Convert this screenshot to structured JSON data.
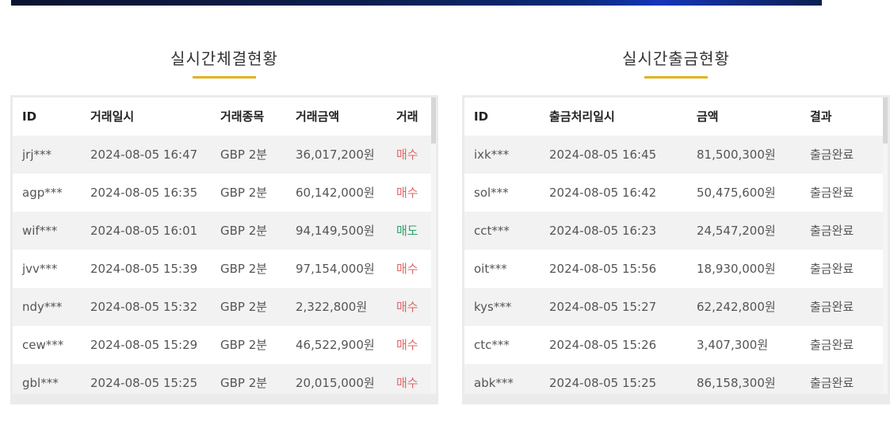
{
  "trades": {
    "title": "실시간체결현황",
    "headers": [
      "ID",
      "거래일시",
      "거래종목",
      "거래금액",
      "거래"
    ],
    "rows": [
      {
        "id": "jrj***",
        "datetime": "2024-08-05 16:47",
        "item": "GBP 2분",
        "amount": "36,017,200원",
        "type": "매수",
        "type_kind": "buy"
      },
      {
        "id": "agp***",
        "datetime": "2024-08-05 16:35",
        "item": "GBP 2분",
        "amount": "60,142,000원",
        "type": "매수",
        "type_kind": "buy"
      },
      {
        "id": "wif***",
        "datetime": "2024-08-05 16:01",
        "item": "GBP 2분",
        "amount": "94,149,500원",
        "type": "매도",
        "type_kind": "sell"
      },
      {
        "id": "jvv***",
        "datetime": "2024-08-05 15:39",
        "item": "GBP 2분",
        "amount": "97,154,000원",
        "type": "매수",
        "type_kind": "buy"
      },
      {
        "id": "ndy***",
        "datetime": "2024-08-05 15:32",
        "item": "GBP 2분",
        "amount": "2,322,800원",
        "type": "매수",
        "type_kind": "buy"
      },
      {
        "id": "cew***",
        "datetime": "2024-08-05 15:29",
        "item": "GBP 2분",
        "amount": "46,522,900원",
        "type": "매수",
        "type_kind": "buy"
      },
      {
        "id": "gbl***",
        "datetime": "2024-08-05 15:25",
        "item": "GBP 2분",
        "amount": "20,015,000원",
        "type": "매수",
        "type_kind": "buy"
      }
    ]
  },
  "withdrawals": {
    "title": "실시간출금현황",
    "headers": [
      "ID",
      "출금처리일시",
      "금액",
      "결과"
    ],
    "rows": [
      {
        "id": "ixk***",
        "datetime": "2024-08-05 16:45",
        "amount": "81,500,300원",
        "result": "출금완료"
      },
      {
        "id": "sol***",
        "datetime": "2024-08-05 16:42",
        "amount": "50,475,600원",
        "result": "출금완료"
      },
      {
        "id": "cct***",
        "datetime": "2024-08-05 16:23",
        "amount": "24,547,200원",
        "result": "출금완료"
      },
      {
        "id": "oit***",
        "datetime": "2024-08-05 15:56",
        "amount": "18,930,000원",
        "result": "출금완료"
      },
      {
        "id": "kys***",
        "datetime": "2024-08-05 15:27",
        "amount": "62,242,800원",
        "result": "출금완료"
      },
      {
        "id": "ctc***",
        "datetime": "2024-08-05 15:26",
        "amount": "3,407,300원",
        "result": "출금완료"
      },
      {
        "id": "abk***",
        "datetime": "2024-08-05 15:25",
        "amount": "86,158,300원",
        "result": "출금완료"
      }
    ]
  },
  "colors": {
    "accent": "#e4b21f",
    "buy": "#e06666",
    "sell": "#2aa36b",
    "stripe": "#f2f2f2",
    "border": "#ebebeb"
  }
}
